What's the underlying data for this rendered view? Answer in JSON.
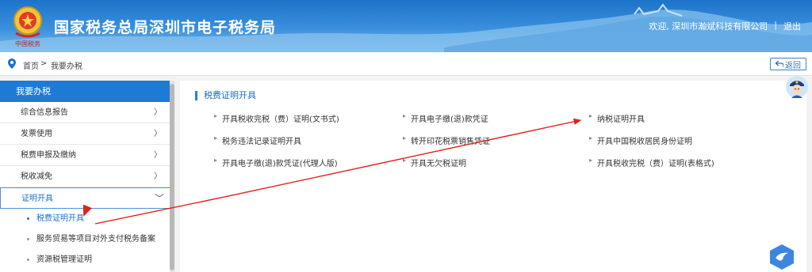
{
  "header": {
    "title": "国家税务总局深圳市电子税务局",
    "emblem_text": "中国税务",
    "welcome_prefix": "欢迎,",
    "company": "深圳市瀚斌科技有限公司",
    "separator": "|",
    "logout": "退出"
  },
  "breadcrumb": {
    "home": "首页",
    "sep": ">",
    "current": "我要办税",
    "back": "返回"
  },
  "sidebar": {
    "heading": "我要办税",
    "items": [
      {
        "label": "综合信息报告",
        "chev": "〉"
      },
      {
        "label": "发票使用",
        "chev": "〉"
      },
      {
        "label": "税费申报及缴纳",
        "chev": "〉"
      },
      {
        "label": "税收减免",
        "chev": "〉"
      },
      {
        "label": "证明开具",
        "chev": "﹀"
      }
    ],
    "sub_items": [
      {
        "label": "税费证明开具"
      },
      {
        "label": "服务贸易等项目对外支付税务备案"
      },
      {
        "label": "资源税管理证明"
      }
    ]
  },
  "main": {
    "section_title": "税费证明开具",
    "links": [
      [
        "开具税收完税（费）证明(文书式)",
        "开具电子缴(退)款凭证",
        "纳税证明开具"
      ],
      [
        "税务违法记录证明开具",
        "转开印花税票销售凭证",
        "开具中国税收居民身份证明"
      ],
      [
        "开具电子缴(退)款凭证(代理人版)",
        "开具无欠税证明",
        "开具税收完税（费）证明(表格式)"
      ]
    ]
  },
  "colors": {
    "accent": "#1f7ad6",
    "annotation_arrow": "#e0201a"
  },
  "icons": {
    "location": "map-pin-icon",
    "back": "back-arrow-icon",
    "assistant": "tax-officer-avatar-icon",
    "bird": "bird-logo-icon"
  }
}
